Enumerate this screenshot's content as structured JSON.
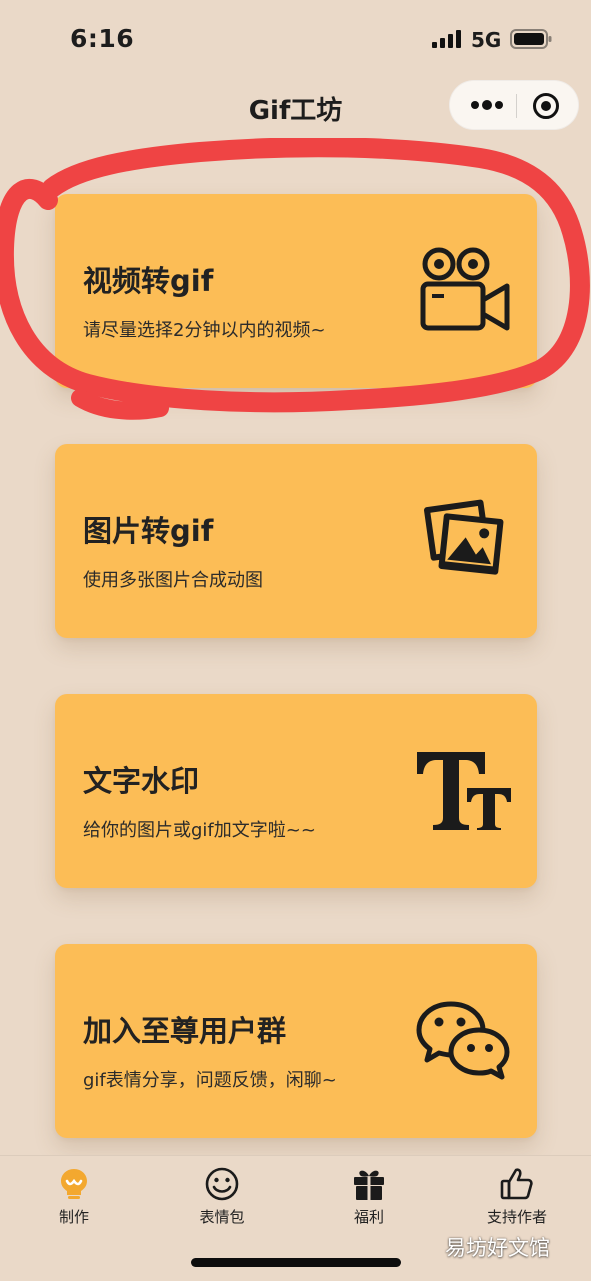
{
  "status_bar": {
    "time": "6:16",
    "network": "5G",
    "icons": [
      "signal-icon",
      "battery-icon"
    ]
  },
  "nav": {
    "title": "Gif工坊",
    "capsule_icons": [
      "more-icon",
      "close-target-icon"
    ]
  },
  "cards": [
    {
      "title": "视频转gif",
      "desc": "请尽量选择2分钟以内的视频~",
      "icon": "video-camera-icon"
    },
    {
      "title": "图片转gif",
      "desc": "使用多张图片合成动图",
      "icon": "photos-icon"
    },
    {
      "title": "文字水印",
      "desc": "给你的图片或gif加文字啦~~",
      "icon": "text-size-icon"
    },
    {
      "title": "加入至尊用户群",
      "desc": "gif表情分享，问题反馈，闲聊~",
      "icon": "wechat-icon"
    }
  ],
  "tabs": [
    {
      "label": "制作",
      "icon": "bulb-icon",
      "active": true
    },
    {
      "label": "表情包",
      "icon": "smiley-icon",
      "active": false
    },
    {
      "label": "福利",
      "icon": "gift-icon",
      "active": false
    },
    {
      "label": "支持作者",
      "icon": "thumbs-up-icon",
      "active": false
    }
  ],
  "watermark": "易坊好文馆",
  "colors": {
    "background": "#ead9c8",
    "card": "#fcbd56",
    "accent": "#f3a82f",
    "highlight_stroke": "#ef4444"
  }
}
